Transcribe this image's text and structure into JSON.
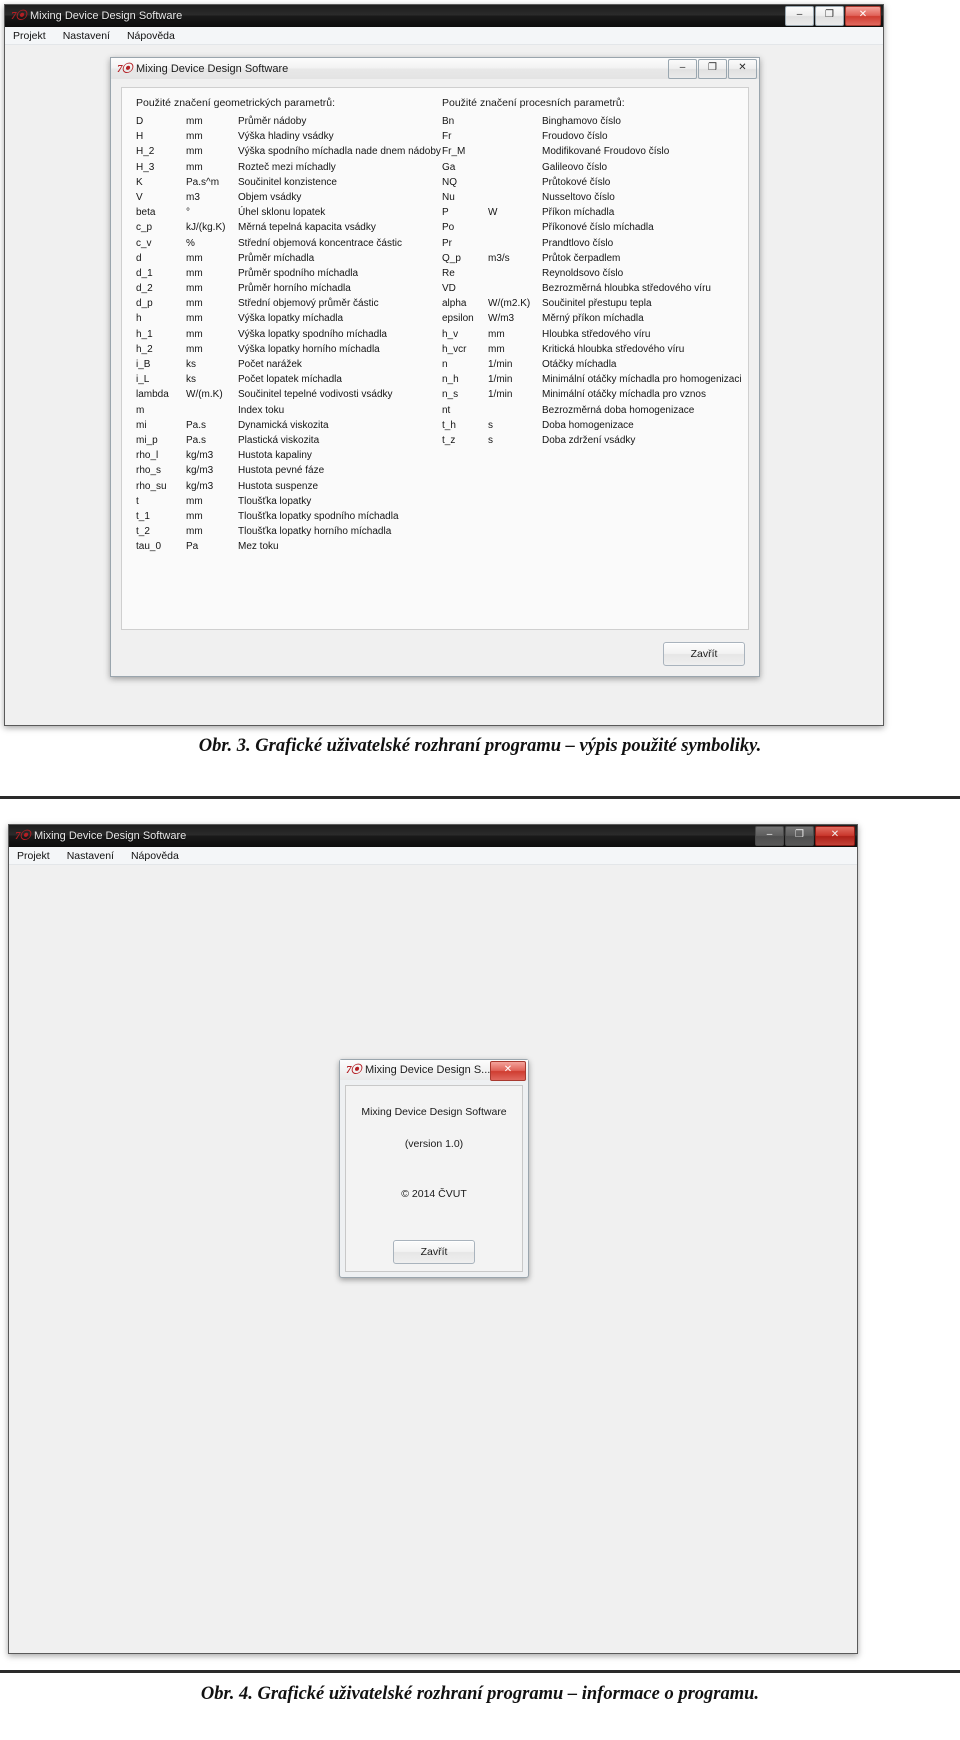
{
  "app": {
    "title": "Mixing Device Design Software",
    "logo_glyph": "7⚗",
    "menu": [
      "Projekt",
      "Nastavení",
      "Nápověda"
    ],
    "window_buttons": {
      "minimize": "–",
      "maximize": "❐",
      "close": "✕"
    }
  },
  "figure3": {
    "dialog_title": "Mixing Device Design Software",
    "geom_header": "Použité značení geometrických parametrů:",
    "proc_header": "Použité značení procesních parametrů:",
    "close_button": "Zavřít",
    "geometric": [
      {
        "sym": "D",
        "unit": "mm",
        "desc": "Průměr nádoby"
      },
      {
        "sym": "H",
        "unit": "mm",
        "desc": "Výška hladiny vsádky"
      },
      {
        "sym": "H_2",
        "unit": "mm",
        "desc": "Výška spodního míchadla nade dnem nádoby"
      },
      {
        "sym": "H_3",
        "unit": "mm",
        "desc": "Rozteč mezi míchadly"
      },
      {
        "sym": "K",
        "unit": "Pa.s^m",
        "desc": "Součinitel konzistence"
      },
      {
        "sym": "V",
        "unit": "m3",
        "desc": "Objem vsádky"
      },
      {
        "sym": "beta",
        "unit": "°",
        "desc": "Úhel sklonu lopatek"
      },
      {
        "sym": "c_p",
        "unit": "kJ/(kg.K)",
        "desc": "Měrná tepelná kapacita vsádky"
      },
      {
        "sym": "c_v",
        "unit": "%",
        "desc": "Střední objemová koncentrace částic"
      },
      {
        "sym": "d",
        "unit": "mm",
        "desc": "Průměr míchadla"
      },
      {
        "sym": "d_1",
        "unit": "mm",
        "desc": "Průměr spodního míchadla"
      },
      {
        "sym": "d_2",
        "unit": "mm",
        "desc": "Průměr horního míchadla"
      },
      {
        "sym": "d_p",
        "unit": "mm",
        "desc": "Střední objemový průměr částic"
      },
      {
        "sym": "h",
        "unit": "mm",
        "desc": "Výška lopatky míchadla"
      },
      {
        "sym": "h_1",
        "unit": "mm",
        "desc": "Výška lopatky spodního míchadla"
      },
      {
        "sym": "h_2",
        "unit": "mm",
        "desc": "Výška lopatky horního míchadla"
      },
      {
        "sym": "i_B",
        "unit": "ks",
        "desc": "Počet narážek"
      },
      {
        "sym": "i_L",
        "unit": "ks",
        "desc": "Počet lopatek míchadla"
      },
      {
        "sym": "lambda",
        "unit": "W/(m.K)",
        "desc": "Součinitel tepelné vodivosti vsádky"
      },
      {
        "sym": "m",
        "unit": "",
        "desc": "Index toku"
      },
      {
        "sym": "mi",
        "unit": "Pa.s",
        "desc": "Dynamická viskozita"
      },
      {
        "sym": "mi_p",
        "unit": "Pa.s",
        "desc": "Plastická viskozita"
      },
      {
        "sym": "rho_l",
        "unit": "kg/m3",
        "desc": "Hustota kapaliny"
      },
      {
        "sym": "rho_s",
        "unit": "kg/m3",
        "desc": "Hustota pevné fáze"
      },
      {
        "sym": "rho_su",
        "unit": "kg/m3",
        "desc": "Hustota suspenze"
      },
      {
        "sym": "t",
        "unit": "mm",
        "desc": "Tloušťka lopatky"
      },
      {
        "sym": "t_1",
        "unit": "mm",
        "desc": "Tloušťka lopatky spodního míchadla"
      },
      {
        "sym": "t_2",
        "unit": "mm",
        "desc": "Tloušťka lopatky horního míchadla"
      },
      {
        "sym": "tau_0",
        "unit": "Pa",
        "desc": "Mez toku"
      }
    ],
    "process": [
      {
        "sym": "Bn",
        "unit": "",
        "desc": "Binghamovo číslo"
      },
      {
        "sym": "Fr",
        "unit": "",
        "desc": "Froudovo číslo"
      },
      {
        "sym": "Fr_M",
        "unit": "",
        "desc": "Modifikované Froudovo číslo"
      },
      {
        "sym": "Ga",
        "unit": "",
        "desc": "Galileovo číslo"
      },
      {
        "sym": "NQ",
        "unit": "",
        "desc": "Průtokové číslo"
      },
      {
        "sym": "Nu",
        "unit": "",
        "desc": "Nusseltovo číslo"
      },
      {
        "sym": "P",
        "unit": "W",
        "desc": "Příkon míchadla"
      },
      {
        "sym": "Po",
        "unit": "",
        "desc": "Příkonové číslo míchadla"
      },
      {
        "sym": "Pr",
        "unit": "",
        "desc": "Prandtlovo číslo"
      },
      {
        "sym": "Q_p",
        "unit": "m3/s",
        "desc": "Průtok čerpadlem"
      },
      {
        "sym": "Re",
        "unit": "",
        "desc": "Reynoldsovo číslo"
      },
      {
        "sym": "VD",
        "unit": "",
        "desc": "Bezrozměrná hloubka středového víru"
      },
      {
        "sym": "alpha",
        "unit": "W/(m2.K)",
        "desc": "Součinitel přestupu tepla"
      },
      {
        "sym": "epsilon",
        "unit": "W/m3",
        "desc": "Měrný příkon míchadla"
      },
      {
        "sym": "h_v",
        "unit": "mm",
        "desc": "Hloubka středového víru"
      },
      {
        "sym": "h_vcr",
        "unit": "mm",
        "desc": "Kritická hloubka středového víru"
      },
      {
        "sym": "n",
        "unit": "1/min",
        "desc": "Otáčky míchadla"
      },
      {
        "sym": "n_h",
        "unit": "1/min",
        "desc": "Minimální otáčky míchadla pro homogenizaci"
      },
      {
        "sym": "n_s",
        "unit": "1/min",
        "desc": "Minimální otáčky míchadla pro vznos"
      },
      {
        "sym": "nt",
        "unit": "",
        "desc": "Bezrozměrná doba homogenizace"
      },
      {
        "sym": "t_h",
        "unit": "s",
        "desc": "Doba homogenizace"
      },
      {
        "sym": "t_z",
        "unit": "s",
        "desc": "Doba zdržení vsádky"
      }
    ],
    "caption": "Obr. 3. Grafické uživatelské rozhraní programu – výpis použité symboliky."
  },
  "figure4": {
    "dialog_title": "Mixing Device Design S...",
    "product_name": "Mixing Device Design Software",
    "version": "(version 1.0)",
    "copyright": "© 2014 ČVUT",
    "close_button": "Zavřít",
    "caption": "Obr. 4. Grafické uživatelské rozhraní programu – informace o programu."
  }
}
